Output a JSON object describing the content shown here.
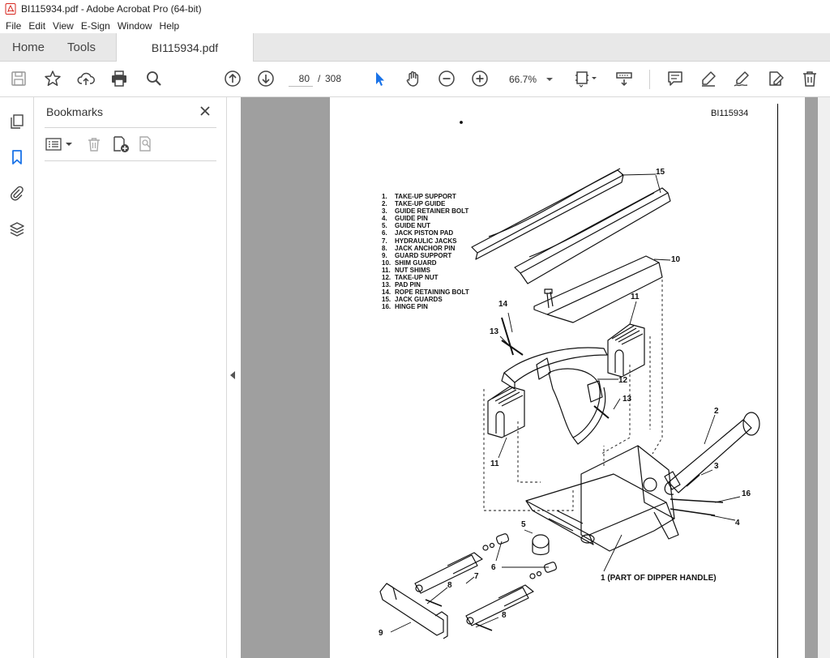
{
  "window": {
    "title": "BI115934.pdf - Adobe Acrobat Pro (64-bit)"
  },
  "menu": [
    "File",
    "Edit",
    "View",
    "E-Sign",
    "Window",
    "Help"
  ],
  "tabs": {
    "home": "Home",
    "tools": "Tools",
    "document": "BI115934.pdf"
  },
  "toolbar": {
    "current_page": "80",
    "page_sep": "/",
    "total_pages": "308",
    "zoom": "66.7%"
  },
  "bookmarks": {
    "title": "Bookmarks"
  },
  "document": {
    "page_id": "BI115934",
    "legend": [
      {
        "n": "1.",
        "t": "TAKE-UP SUPPORT"
      },
      {
        "n": "2.",
        "t": "TAKE-UP GUIDE"
      },
      {
        "n": "3.",
        "t": "GUIDE RETAINER BOLT"
      },
      {
        "n": "4.",
        "t": "GUIDE PIN"
      },
      {
        "n": "5.",
        "t": "GUIDE NUT"
      },
      {
        "n": "6.",
        "t": "JACK PISTON PAD"
      },
      {
        "n": "7.",
        "t": "HYDRAULIC JACKS"
      },
      {
        "n": "8.",
        "t": "JACK ANCHOR PIN"
      },
      {
        "n": "9.",
        "t": "GUARD SUPPORT"
      },
      {
        "n": "10.",
        "t": "SHIM GUARD"
      },
      {
        "n": "11.",
        "t": "NUT SHIMS"
      },
      {
        "n": "12.",
        "t": "TAKE-UP NUT"
      },
      {
        "n": "13.",
        "t": "PAD PIN"
      },
      {
        "n": "14.",
        "t": "ROPE RETAINING BOLT"
      },
      {
        "n": "15.",
        "t": "JACK GUARDS"
      },
      {
        "n": "16.",
        "t": "HINGE PIN"
      }
    ],
    "callouts": {
      "c15": "15",
      "c10": "10",
      "c11a": "11",
      "c14": "14",
      "c13a": "13",
      "c12": "12",
      "c13b": "13",
      "c11b": "11",
      "c2": "2",
      "c3": "3",
      "c16": "16",
      "c4": "4",
      "c5": "5",
      "c6": "6",
      "c7": "7",
      "c8a": "8",
      "c8b": "8",
      "c9": "9",
      "c1": "1 (PART OF DIPPER HANDLE)"
    }
  },
  "colors": {
    "accent": "#1a73e8",
    "acrobat_red": "#d7261e",
    "doc_bg": "#9f9f9f"
  }
}
